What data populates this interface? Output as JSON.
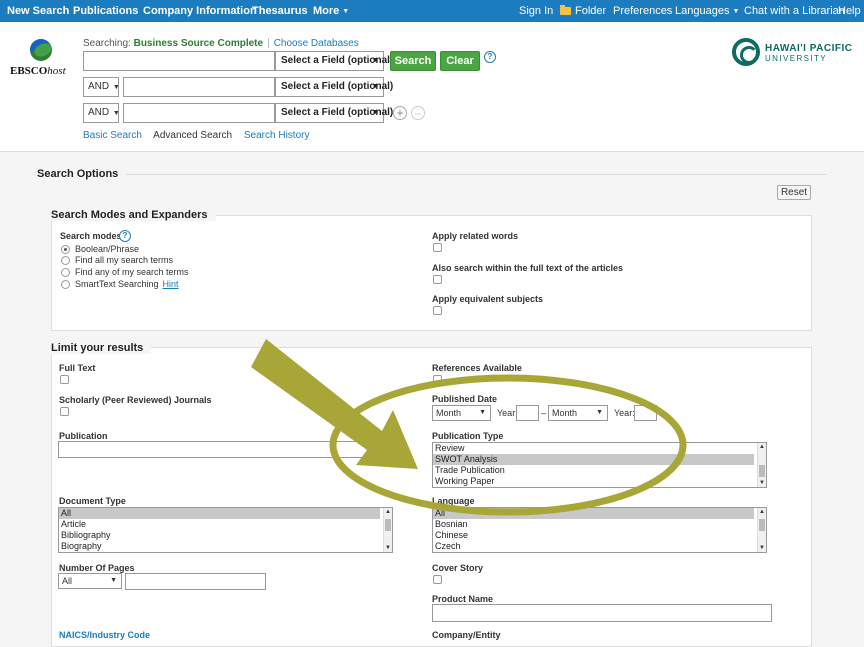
{
  "topnav": {
    "new_search": "New Search",
    "publications": "Publications",
    "company_information": "Company Information",
    "thesaurus": "Thesaurus",
    "more": "More",
    "sign_in": "Sign In",
    "folder": "Folder",
    "preferences": "Preferences",
    "languages": "Languages",
    "chat": "Chat with a Librarian",
    "help": "Help"
  },
  "header": {
    "logo_text_bold": "EBSCO",
    "logo_text_italic": "host",
    "searching_label": "Searching:",
    "database": "Business Source Complete",
    "choose_databases": "Choose Databases",
    "field_placeholder": "Select a Field (optional)",
    "search_button": "Search",
    "clear_button": "Clear",
    "bool_op_1": "AND",
    "bool_op_2": "AND",
    "basic_search": "Basic Search",
    "advanced_search": "Advanced Search",
    "search_history": "Search History",
    "university_name": "HAWAI'I PACIFIC",
    "university_sub": "UNIVERSITY"
  },
  "options": {
    "title": "Search Options",
    "reset": "Reset",
    "modes_title": "Search Modes and Expanders",
    "search_modes_label": "Search modes",
    "modes": [
      "Boolean/Phrase",
      "Find all my search terms",
      "Find any of my search terms",
      "SmartText Searching"
    ],
    "selected_mode": "Boolean/Phrase",
    "hint": "Hint",
    "apply_related": "Apply related words",
    "full_text_expander": "Also search within the full text of the articles",
    "apply_equivalent": "Apply equivalent subjects"
  },
  "limits": {
    "title": "Limit your results",
    "full_text": "Full Text",
    "scholarly": "Scholarly (Peer Reviewed) Journals",
    "publication": "Publication",
    "document_type": "Document Type",
    "document_types": [
      "All",
      "Article",
      "Bibliography",
      "Biography"
    ],
    "number_of_pages": "Number Of Pages",
    "pages_select": "All",
    "naics": "NAICS/Industry Code",
    "references_available": "References Available",
    "published_date": "Published Date",
    "month_1": "Month",
    "year_1": "Year:",
    "dash": "–",
    "month_2": "Month",
    "year_2": "Year:",
    "publication_type": "Publication Type",
    "publication_types": [
      "Review",
      "SWOT Analysis",
      "Trade Publication",
      "Working Paper"
    ],
    "selected_publication_type": "SWOT Analysis",
    "language": "Language",
    "languages": [
      "All",
      "Bosnian",
      "Chinese",
      "Czech"
    ],
    "cover_story": "Cover Story",
    "product_name": "Product Name",
    "company_entity": "Company/Entity"
  },
  "colors": {
    "nav": "#1b7cc0",
    "green_button": "#4aa642",
    "annotation": "#a7a637"
  },
  "icons": [
    "help-icon",
    "folder-icon",
    "plus-icon",
    "minus-icon",
    "arrow-annotation",
    "ellipse-annotation"
  ]
}
